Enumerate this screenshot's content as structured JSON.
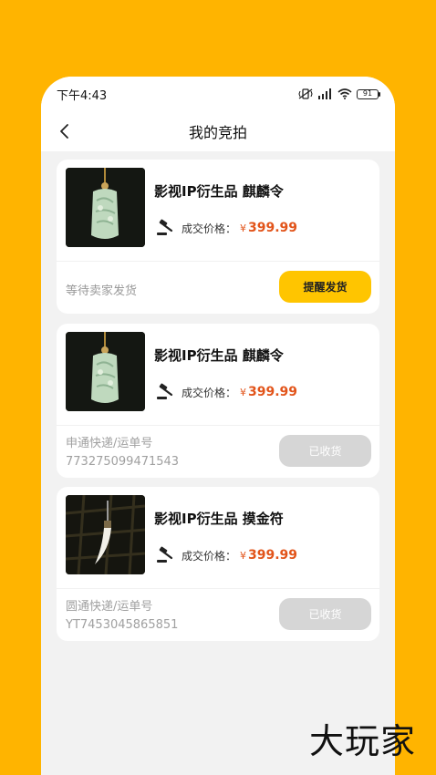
{
  "status_bar": {
    "time": "下午4:43",
    "battery": "91"
  },
  "header": {
    "title": "我的竞拍"
  },
  "orders": [
    {
      "title": "影视IP衍生品 麒麟令",
      "price_label": "成交价格：",
      "currency": "¥",
      "price": "399.99",
      "status_text": "等待卖家发货",
      "action_label": "提醒发货"
    },
    {
      "title": "影视IP衍生品 麒麟令",
      "price_label": "成交价格：",
      "currency": "¥",
      "price": "399.99",
      "courier": "申通快递/运单号",
      "tracking_no": "773275099471543",
      "action_label": "已收货"
    },
    {
      "title": "影视IP衍生品 摸金符",
      "price_label": "成交价格：",
      "currency": "¥",
      "price": "399.99",
      "courier": "圆通快递/运单号",
      "tracking_no": "YT7453045865851",
      "action_label": "已收货"
    }
  ],
  "watermark": "大玩家",
  "colors": {
    "background": "#FFB400",
    "accent": "#FFC500",
    "price": "#E2541A"
  },
  "icons": [
    "back-chevron-icon",
    "gavel-icon",
    "battery-icon",
    "wifi-icon",
    "signal-icon"
  ]
}
